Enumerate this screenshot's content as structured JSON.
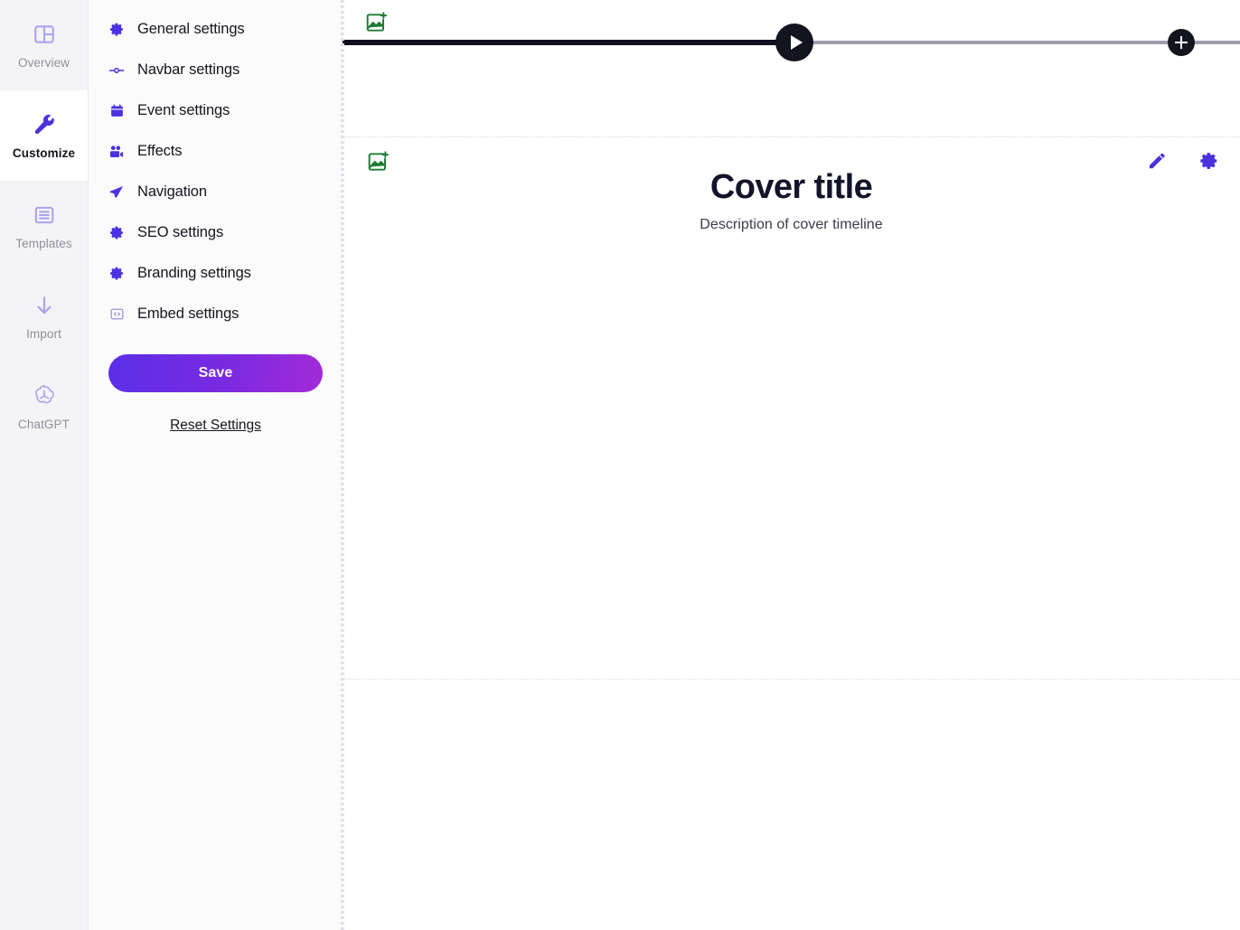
{
  "rail": {
    "items": [
      {
        "label": "Overview",
        "icon": "layout-panels-icon",
        "active": false
      },
      {
        "label": "Customize",
        "icon": "wrench-icon",
        "active": true
      },
      {
        "label": "Templates",
        "icon": "list-lines-icon",
        "active": false
      },
      {
        "label": "Import",
        "icon": "arrow-down-icon",
        "active": false
      },
      {
        "label": "ChatGPT",
        "icon": "chatgpt-logo-icon",
        "active": false
      }
    ]
  },
  "panel": {
    "menu": [
      {
        "label": "General settings",
        "icon": "gear-icon"
      },
      {
        "label": "Navbar settings",
        "icon": "slider-icon"
      },
      {
        "label": "Event settings",
        "icon": "calendar-icon"
      },
      {
        "label": "Effects",
        "icon": "video-camera-icon"
      },
      {
        "label": "Navigation",
        "icon": "paper-plane-icon"
      },
      {
        "label": "SEO settings",
        "icon": "gear-icon"
      },
      {
        "label": "Branding settings",
        "icon": "gear-icon"
      },
      {
        "label": "Embed settings",
        "icon": "code-embed-icon"
      }
    ],
    "save_label": "Save",
    "reset_label": "Reset Settings"
  },
  "canvas": {
    "timeline": {
      "add_image_icon": "add-image-icon",
      "play_icon": "play-icon",
      "add_node_icon": "plus-icon",
      "progress_percent": 50
    },
    "cover": {
      "add_image_icon": "add-image-icon",
      "title": "Cover title",
      "description": "Description of cover timeline",
      "edit_icon": "pencil-icon",
      "settings_icon": "gear-icon"
    }
  },
  "colors": {
    "accent_purple": "#4b32e0",
    "accent_purple_light": "#a9a2ef",
    "gradient_start": "#5b2fe8",
    "gradient_end": "#a22ad8",
    "green_icon": "#1f7a33",
    "dark": "#14141f",
    "track_gray": "#9d9dae"
  }
}
